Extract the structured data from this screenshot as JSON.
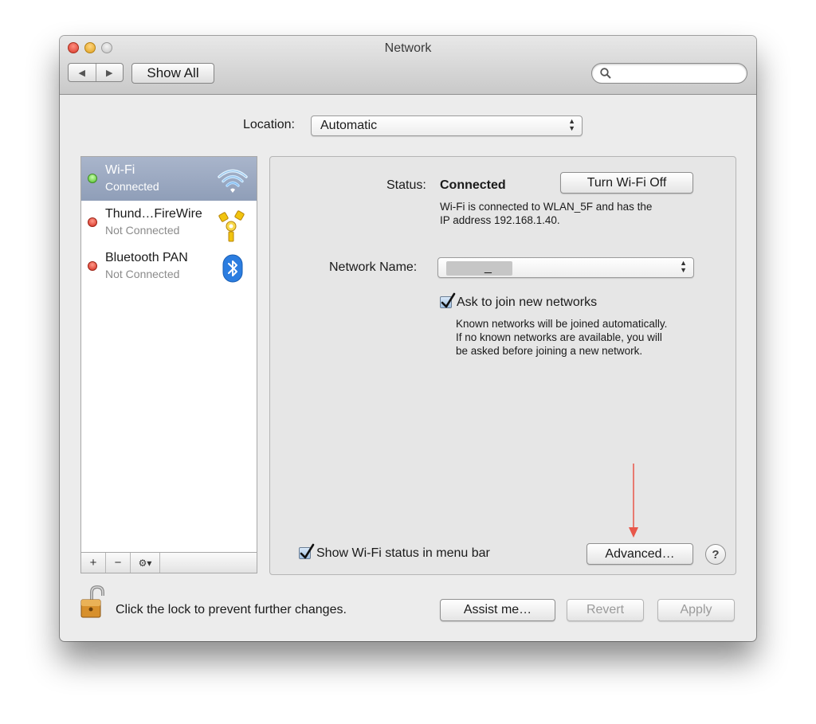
{
  "window": {
    "title": "Network"
  },
  "toolbar": {
    "back": "◀",
    "forward": "▶",
    "show_all": "Show All",
    "search_placeholder": ""
  },
  "location": {
    "label": "Location:",
    "value": "Automatic"
  },
  "services": [
    {
      "name": "Wi-Fi",
      "status": "Connected",
      "state": "green",
      "icon": "wifi-icon"
    },
    {
      "name": "Thund…FireWire",
      "status": "Not Connected",
      "state": "red",
      "icon": "firewire-icon"
    },
    {
      "name": "Bluetooth PAN",
      "status": "Not Connected",
      "state": "red",
      "icon": "bluetooth-icon"
    }
  ],
  "sidebar_toolbar": {
    "add": "+",
    "remove": "−",
    "action": "⚙▾"
  },
  "detail": {
    "status_label": "Status:",
    "status_value": "Connected",
    "toggle_button": "Turn Wi-Fi Off",
    "status_line1": "Wi-Fi is connected to WLAN_5F and has the",
    "status_line2": "IP address 192.168.1.40.",
    "network_name_label": "Network Name:",
    "network_name_value": "_",
    "ask_join_label": "Ask to join new networks",
    "ask_join_checked": true,
    "ask_join_help1": "Known networks will be joined automatically.",
    "ask_join_help2": "If no known networks are available, you will",
    "ask_join_help3": "be asked before joining a new network.",
    "show_status_label": "Show Wi-Fi status in menu bar",
    "show_status_checked": true,
    "advanced_button": "Advanced…",
    "help_button": "?"
  },
  "footer": {
    "lock_text": "Click the lock to prevent further changes.",
    "assist_button": "Assist me…",
    "revert_button": "Revert",
    "apply_button": "Apply"
  },
  "colors": {
    "selection": "#95a3bc",
    "annotation_arrow": "#e8574a",
    "status_connected": "#4fbd25",
    "status_disconnected": "#d52b1e"
  }
}
